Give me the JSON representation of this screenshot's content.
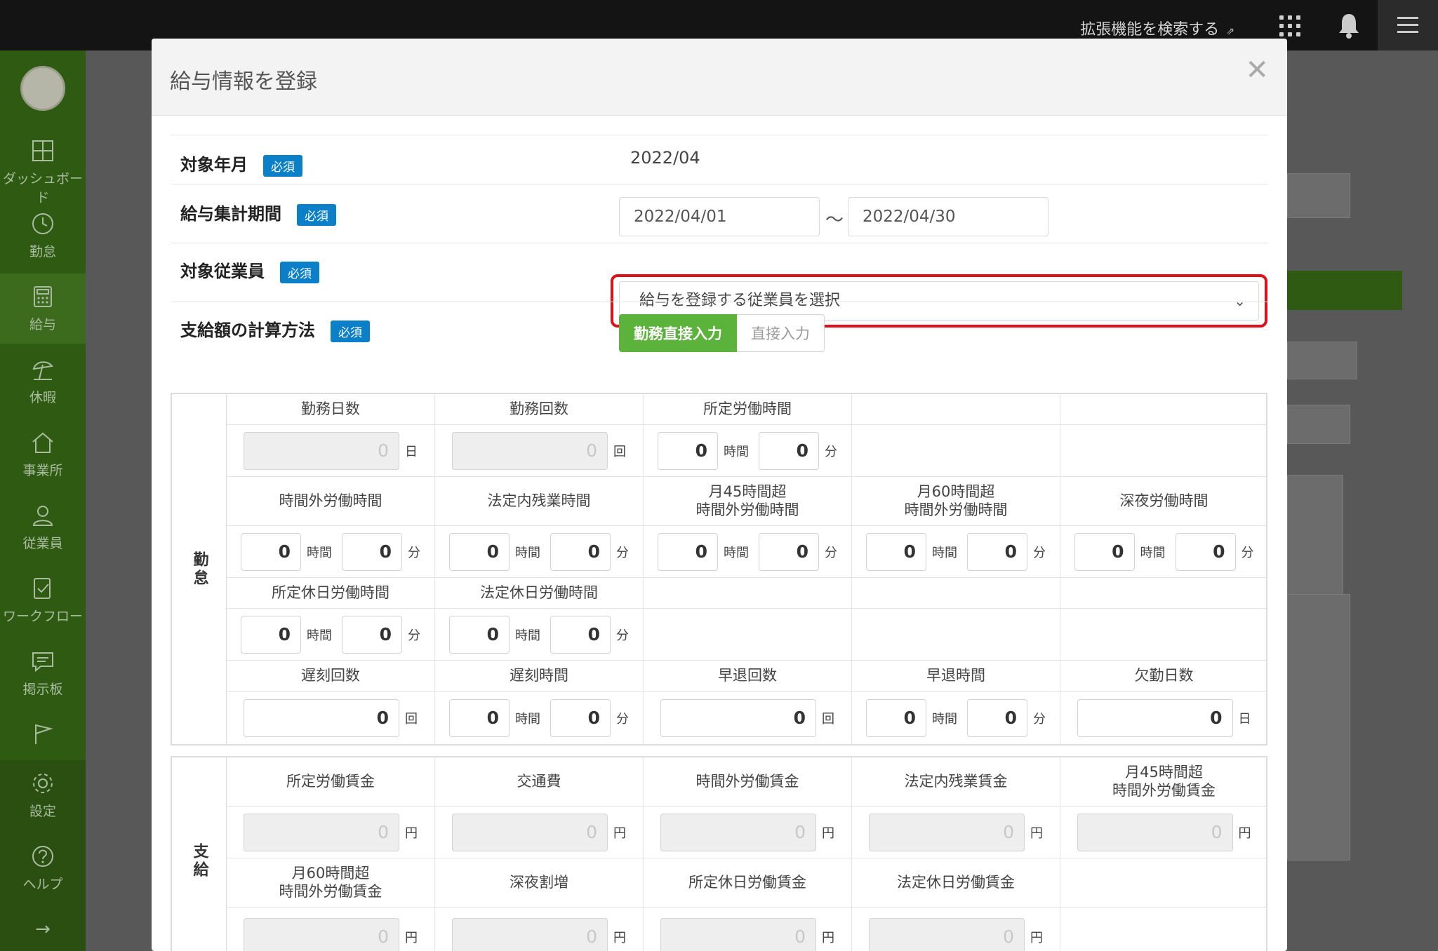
{
  "topbar": {
    "extension_search": "拡張機能を検索する",
    "extension_icon": "external-link-icon"
  },
  "sidebar": {
    "items": [
      {
        "label": "ダッシュボード",
        "icon": "dashboard-icon"
      },
      {
        "label": "勤怠",
        "icon": "clock-icon"
      },
      {
        "label": "給与",
        "icon": "calculator-icon",
        "active": true
      },
      {
        "label": "休暇",
        "icon": "beach-umbrella-icon"
      },
      {
        "label": "事業所",
        "icon": "home-icon"
      },
      {
        "label": "従業員",
        "icon": "person-icon"
      },
      {
        "label": "ワークフロー",
        "icon": "workflow-icon"
      },
      {
        "label": "掲示板",
        "icon": "message-icon"
      },
      {
        "label": "",
        "icon": "flag-icon"
      },
      {
        "label": "設定",
        "icon": "gear-icon"
      },
      {
        "label": "ヘルプ",
        "icon": "help-icon"
      }
    ],
    "expand_icon": "→"
  },
  "colors": {
    "sidebar": "#2f5a12",
    "accent_green": "#5bb33b",
    "badge_blue": "#0b7fc7",
    "highlight_red": "#e0101b"
  },
  "modal": {
    "title": "給与情報を登録",
    "close": "✕",
    "required": "必須",
    "rows": {
      "target_month": {
        "label": "対象年月",
        "value": "2022/04"
      },
      "period": {
        "label": "給与集計期間",
        "start": "2022/04/01",
        "sep": "〜",
        "end": "2022/04/30"
      },
      "employee": {
        "label": "対象従業員",
        "placeholder": "給与を登録する従業員を選択"
      },
      "calc_method": {
        "label": "支給額の計算方法",
        "option_selected": "勤務直接入力",
        "option_other": "直接入力"
      }
    },
    "units": {
      "day": "日",
      "count": "回",
      "hour": "時間",
      "minute": "分",
      "yen": "円"
    },
    "attendance": {
      "section_label": "勤怠",
      "work_days": "勤務日数",
      "work_times": "勤務回数",
      "scheduled_hours": "所定労働時間",
      "overtime": "時間外労働時間",
      "legal_overtime": "法定内残業時間",
      "over45": "月45時間超\n時間外労働時間",
      "over60": "月60時間超\n時間外労働時間",
      "night": "深夜労働時間",
      "scheduled_holiday": "所定休日労働時間",
      "legal_holiday": "法定休日労働時間",
      "late_count": "遅刻回数",
      "late_time": "遅刻時間",
      "early_count": "早退回数",
      "early_time": "早退時間",
      "absence_days": "欠勤日数",
      "zero": "0"
    },
    "payment": {
      "section_label": "支給",
      "scheduled_wage": "所定労働賃金",
      "transport": "交通費",
      "overtime_wage": "時間外労働賃金",
      "legal_overtime_wage": "法定内残業賃金",
      "over45_wage": "月45時間超\n時間外労働賃金",
      "over60_wage": "月60時間超\n時間外労働賃金",
      "night_premium": "深夜割増",
      "scheduled_holiday_wage": "所定休日労働賃金",
      "legal_holiday_wage": "法定休日労働賃金",
      "zero": "0"
    }
  }
}
